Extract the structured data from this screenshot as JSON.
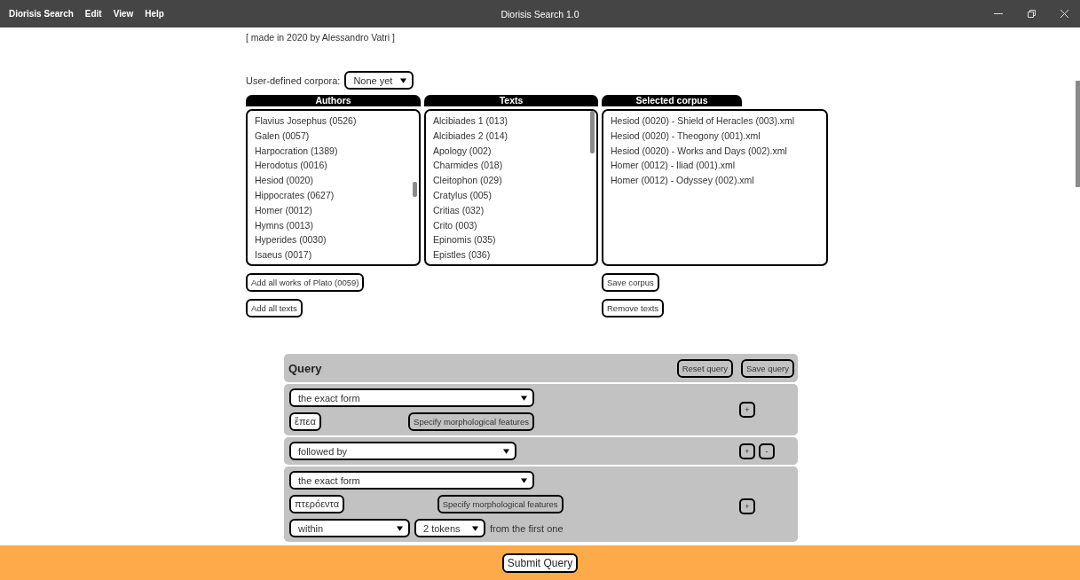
{
  "window": {
    "title": "Diorisis Search 1.0"
  },
  "menu": [
    "Diorisis Search",
    "Edit",
    "View",
    "Help"
  ],
  "credit": "[ made in 2020 by Alessandro Vatri ]",
  "corpora": {
    "label": "User-defined corpora:",
    "value": "None yet"
  },
  "lists": [
    {
      "heading": "Authors",
      "items": [
        "Flavius Josephus (0526)",
        "Galen (0057)",
        "Harpocration (1389)",
        "Herodotus (0016)",
        "Hesiod (0020)",
        "Hippocrates (0627)",
        "Homer (0012)",
        "Hymns (0013)",
        "Hyperides (0030)",
        "Isaeus (0017)"
      ],
      "buttons": [
        "Add all works of Plato (0059)",
        "Add all texts"
      ]
    },
    {
      "heading": "Texts",
      "items": [
        "Alcibiades 1 (013)",
        "Alcibiades 2 (014)",
        "Apology (002)",
        "Charmides (018)",
        "Cleitophon (029)",
        "Cratylus (005)",
        "Critias (032)",
        "Crito (003)",
        "Epinomis (035)",
        "Epistles (036)"
      ]
    },
    {
      "heading": "Selected corpus",
      "items": [
        "Hesiod (0020) - Shield of Heracles (003).xml",
        "Hesiod (0020) - Theogony (001).xml",
        "Hesiod (0020) - Works and Days (002).xml",
        "Homer (0012) - Iliad (001).xml",
        "Homer (0012) - Odyssey (002).xml"
      ],
      "buttons": [
        "Save corpus",
        "Remove texts"
      ]
    }
  ],
  "query": {
    "title": "Query",
    "buttons": [
      "Reset query",
      "Save query"
    ],
    "blocks": [
      {
        "kind": "term",
        "select": "the exact form",
        "value": "ἔπεα",
        "morph": "Specify morphological features",
        "actions": [
          "+"
        ]
      },
      {
        "kind": "connector",
        "select": "followed by",
        "actions": [
          "+",
          "-"
        ]
      },
      {
        "kind": "term",
        "select": "the exact form",
        "value": "πτερόεντα",
        "morph": "Specify morphological features",
        "actions": [
          "+"
        ],
        "distance": {
          "select": "within",
          "amount": "2 tokens",
          "note": "from the first one"
        }
      }
    ]
  },
  "submit": "Submit Query"
}
